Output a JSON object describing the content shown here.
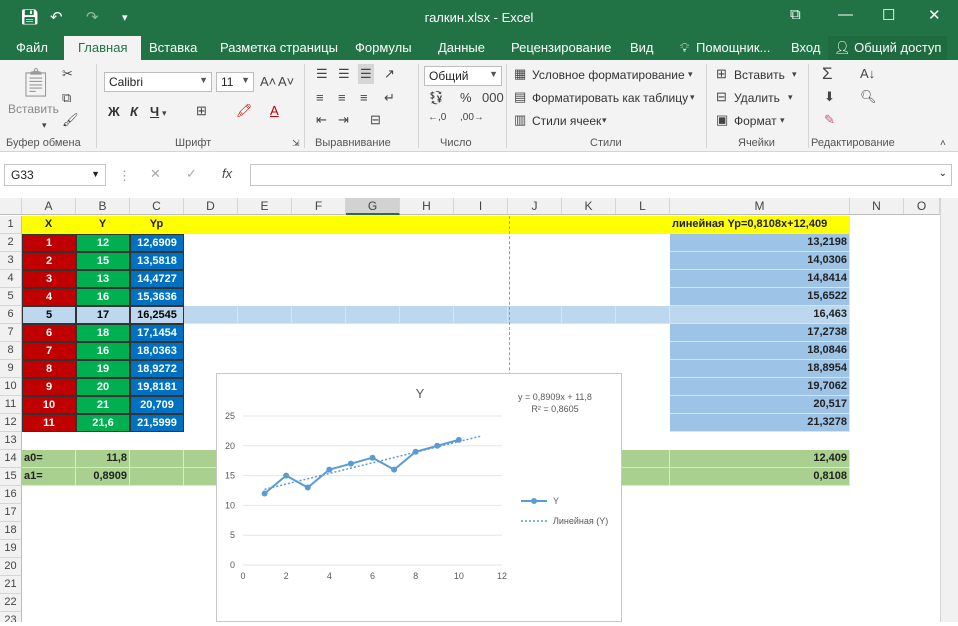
{
  "window": {
    "title": "галкин.xlsx - Excel"
  },
  "tabs": [
    "Файл",
    "Главная",
    "Вставка",
    "Разметка страницы",
    "Формулы",
    "Данные",
    "Рецензирование",
    "Вид",
    "Помощник...",
    "Вход",
    "Общий доступ"
  ],
  "ribbon": {
    "paste": "Вставить",
    "clipboard": "Буфер обмена",
    "font_name": "Calibri",
    "font_size": "11",
    "bold": "Ж",
    "italic": "К",
    "underline": "Ч",
    "font_group": "Шрифт",
    "align_group": "Выравнивание",
    "number_format": "Общий",
    "number_group": "Число",
    "cond_format": "Условное форматирование",
    "format_table": "Форматировать как таблицу",
    "cell_styles": "Стили ячеек",
    "styles_group": "Стили",
    "insert": "Вставить",
    "delete": "Удалить",
    "format": "Формат",
    "cells_group": "Ячейки",
    "editing_group": "Редактирование"
  },
  "formula_bar": {
    "name_box": "G33",
    "fx": "fx",
    "formula": ""
  },
  "columns": [
    "A",
    "B",
    "C",
    "D",
    "E",
    "F",
    "G",
    "H",
    "I",
    "J",
    "K",
    "L",
    "M",
    "N",
    "O"
  ],
  "rows": [
    "1",
    "2",
    "3",
    "4",
    "5",
    "6",
    "7",
    "8",
    "9",
    "10",
    "11",
    "12",
    "13",
    "14",
    "15",
    "16",
    "17",
    "18",
    "19",
    "20",
    "21",
    "22",
    "23"
  ],
  "table": {
    "headers": [
      "X",
      "Y",
      "Yp"
    ],
    "x": [
      "1",
      "2",
      "3",
      "4",
      "5",
      "6",
      "7",
      "8",
      "9",
      "10",
      "11"
    ],
    "y": [
      "12",
      "15",
      "13",
      "16",
      "17",
      "18",
      "16",
      "19",
      "20",
      "21",
      "21,6"
    ],
    "yp": [
      "12,6909",
      "13,5818",
      "14,4727",
      "15,3636",
      "16,2545",
      "17,1454",
      "18,0363",
      "18,9272",
      "19,8181",
      "20,709",
      "21,5999"
    ]
  },
  "m_col": {
    "header": "линейная Yp=0,8108x+12,409",
    "values": [
      "13,2198",
      "14,0306",
      "14,8414",
      "15,6522",
      "16,463",
      "17,2738",
      "18,0846",
      "18,8954",
      "19,7062",
      "20,517",
      "21,3278"
    ],
    "a0": "12,409",
    "a1": "0,8108"
  },
  "coef": {
    "a0_label": "a0=",
    "a0_value": "11,8",
    "a1_label": "a1=",
    "a1_value": "0,8909"
  },
  "chart_data": {
    "type": "line",
    "title": "Y",
    "x": [
      1,
      2,
      3,
      4,
      5,
      6,
      7,
      8,
      9,
      10
    ],
    "series": [
      {
        "name": "Y",
        "values": [
          12,
          15,
          13,
          16,
          17,
          18,
          16,
          19,
          20,
          21
        ]
      }
    ],
    "trendline": {
      "name": "Линейная (Y)",
      "slope": 0.8909,
      "intercept": 11.8
    },
    "equation": "y = 0,8909x + 11,8",
    "r2": "R² = 0,8605",
    "xlim": [
      0,
      12
    ],
    "ylim": [
      0,
      25
    ],
    "xticks": [
      "0",
      "2",
      "4",
      "6",
      "8",
      "10",
      "12"
    ],
    "yticks": [
      "0",
      "5",
      "10",
      "15",
      "20",
      "25"
    ],
    "legend": "right",
    "colors": {
      "series": "#5b9bd5"
    }
  }
}
